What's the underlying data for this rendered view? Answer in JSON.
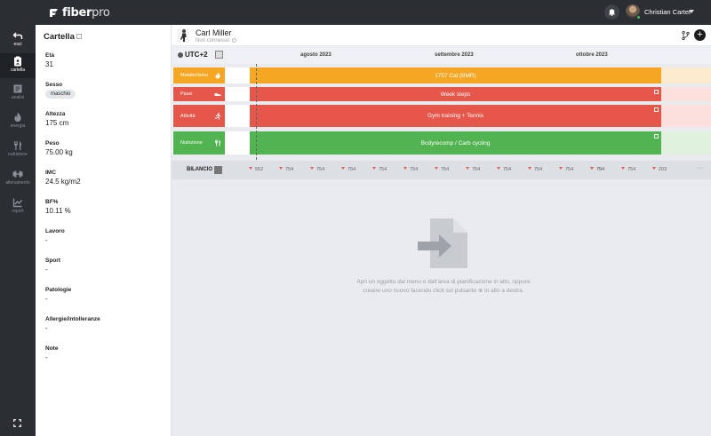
{
  "app": {
    "brand_main": "fiber",
    "brand_suffix": "pro"
  },
  "topbar": {
    "user_name": "Christian Carter",
    "notifications_icon": "bell-icon"
  },
  "leftnav": {
    "items": [
      {
        "label": "esci",
        "icon": "arrow-back-icon"
      },
      {
        "label": "cartella",
        "icon": "folder-person-icon"
      },
      {
        "label": "analisi",
        "icon": "document-list-icon"
      },
      {
        "label": "energia",
        "icon": "flame-icon"
      },
      {
        "label": "nutrizione",
        "icon": "fork-knife-icon"
      },
      {
        "label": "allenamento",
        "icon": "dumbbell-icon"
      },
      {
        "label": "report",
        "icon": "chart-line-icon"
      }
    ]
  },
  "profile": {
    "title": "Cartella",
    "fields": [
      {
        "label": "Età",
        "value": "31"
      },
      {
        "label": "Sesso",
        "value": "maschio"
      },
      {
        "label": "Altezza",
        "value": "175 cm"
      },
      {
        "label": "Peso",
        "value": "75.00 kg"
      },
      {
        "label": "IMC",
        "value": "24.5 kg/m2"
      },
      {
        "label": "BF%",
        "value": "10.11 %"
      },
      {
        "label": "Lavoro",
        "value": "-"
      },
      {
        "label": "Sport",
        "value": "-"
      },
      {
        "label": "Patologie",
        "value": "-"
      },
      {
        "label": "Allergie/intolleranze",
        "value": "-"
      },
      {
        "label": "Note",
        "value": "-"
      }
    ]
  },
  "client": {
    "name": "Carl Miller",
    "status": "Non connesso"
  },
  "timeline": {
    "timezone": "UTC+2",
    "months": [
      "agosto 2023",
      "settembre 2023",
      "ottobre 2023"
    ],
    "lanes": [
      {
        "label": "Metabolismo",
        "bar": "1757 Cal (BMR)",
        "color": "#f5a623",
        "light": "#fdebd0"
      },
      {
        "label": "Passi",
        "bar": "Week steps",
        "color": "#e5574a",
        "light": "#fbe0dd"
      },
      {
        "label": "Attività",
        "bar": "Gym training + Tennis",
        "color": "#e5574a",
        "light": "#fbe0dd"
      },
      {
        "label": "Nutrizione",
        "bar": "Bodyrecomp / Carb cycling",
        "color": "#52b351",
        "light": "#e0f1de"
      }
    ],
    "bilancio": {
      "label": "BILANCIO",
      "values": [
        "552",
        "754",
        "754",
        "754",
        "754",
        "754",
        "754",
        "754",
        "754",
        "754",
        "754",
        "754",
        "754",
        "754",
        "203"
      ],
      "more": "···"
    }
  },
  "empty_state": {
    "line1": "Apri un oggetto dal menu o dall'area di pianificazione in alto, oppure",
    "line2": "creane uno nuovo facendo click sul pulsante ⊕ in alto a destra."
  }
}
